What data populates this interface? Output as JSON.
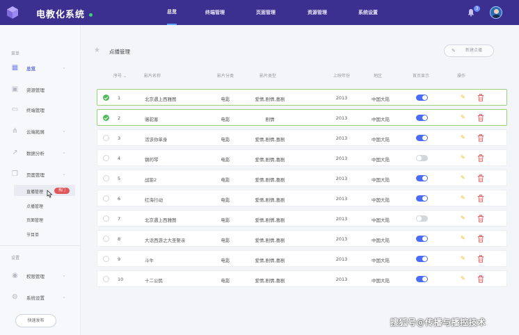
{
  "app": {
    "brand": "电教化系统",
    "nav": [
      {
        "label": "总览",
        "active": true
      },
      {
        "label": "终端管理",
        "active": false
      },
      {
        "label": "页面管理",
        "active": false
      },
      {
        "label": "资源管理",
        "active": false
      },
      {
        "label": "系统设置",
        "active": false
      }
    ],
    "notification_count": "3"
  },
  "sidebar": {
    "menu_title": "菜单",
    "items": [
      {
        "label": "总览",
        "icon": "grid-icon",
        "active": true,
        "expandable": true
      },
      {
        "label": "资源管理",
        "icon": "briefcase-icon",
        "active": false,
        "expandable": false
      },
      {
        "label": "终端管理",
        "icon": "monitor-icon",
        "active": false,
        "expandable": false
      },
      {
        "label": "云端拓展",
        "icon": "network-icon",
        "active": false,
        "expandable": true
      },
      {
        "label": "数据分析",
        "icon": "trend-icon",
        "active": false,
        "expandable": true
      },
      {
        "label": "页面管理",
        "icon": "pages-icon",
        "active": false,
        "expandable": true
      }
    ],
    "subitems": [
      {
        "label": "直播管理",
        "active": true
      },
      {
        "label": "点播管理",
        "active": false
      },
      {
        "label": "页面管理",
        "active": false
      },
      {
        "label": "节目单",
        "active": false
      }
    ],
    "hot_badge": "热门",
    "settings_title": "设置",
    "settings_items": [
      {
        "label": "权限管理",
        "icon": "user-icon"
      },
      {
        "label": "系统设置",
        "icon": "gear-icon"
      }
    ],
    "quick_publish": "快速发布"
  },
  "main": {
    "title": "点播管理",
    "new_button": "新建点播",
    "columns": [
      "序号",
      "影片名称",
      "影片分类",
      "影片类型",
      "上映年份",
      "地区",
      "首页显示",
      "操作"
    ],
    "rows": [
      {
        "no": "1",
        "name": "北京遇上西雅图",
        "category": "电影",
        "genre": "爱情,剧情,喜剧",
        "year": "2013",
        "region": "中国大陆",
        "show": true,
        "selected": true
      },
      {
        "no": "2",
        "name": "骆驼客",
        "category": "电影",
        "genre": "剧情",
        "year": "2013",
        "region": "中国大陆",
        "show": true,
        "selected": true
      },
      {
        "no": "3",
        "name": "活该你单身",
        "category": "电影",
        "genre": "爱情,剧情,喜剧",
        "year": "2013",
        "region": "中国大陆",
        "show": true,
        "selected": false
      },
      {
        "no": "4",
        "name": "钢的琴",
        "category": "电影",
        "genre": "爱情,剧情,喜剧",
        "year": "2013",
        "region": "中国大陆",
        "show": false,
        "selected": false
      },
      {
        "no": "5",
        "name": "战狼2",
        "category": "电影",
        "genre": "爱情,剧情,喜剧",
        "year": "2013",
        "region": "中国大陆",
        "show": true,
        "selected": false
      },
      {
        "no": "6",
        "name": "红海行动",
        "category": "电影",
        "genre": "爱情,剧情,喜剧",
        "year": "2013",
        "region": "中国大陆",
        "show": true,
        "selected": false
      },
      {
        "no": "7",
        "name": "北京遇上西雅图",
        "category": "电影",
        "genre": "爱情,剧情,喜剧",
        "year": "2013",
        "region": "中国大陆",
        "show": false,
        "selected": false
      },
      {
        "no": "8",
        "name": "大话西游之大圣娶亲",
        "category": "电影",
        "genre": "爱情,剧情,喜剧",
        "year": "2013",
        "region": "中国大陆",
        "show": true,
        "selected": false
      },
      {
        "no": "9",
        "name": "斗牛",
        "category": "电影",
        "genre": "爱情,剧情,喜剧",
        "year": "2013",
        "region": "中国大陆",
        "show": true,
        "selected": false
      },
      {
        "no": "10",
        "name": "十二公民",
        "category": "电影",
        "genre": "爱情,剧情,喜剧",
        "year": "2013",
        "region": "中国大陆",
        "show": true,
        "selected": false
      }
    ]
  },
  "watermark": "搜狐号@传播与播控技术",
  "colors": {
    "topbar": "#3b2f8f",
    "accent": "#4a6cf7",
    "selected_border": "#9bd07a",
    "edit": "#f2b81b",
    "delete": "#e05a5a"
  }
}
